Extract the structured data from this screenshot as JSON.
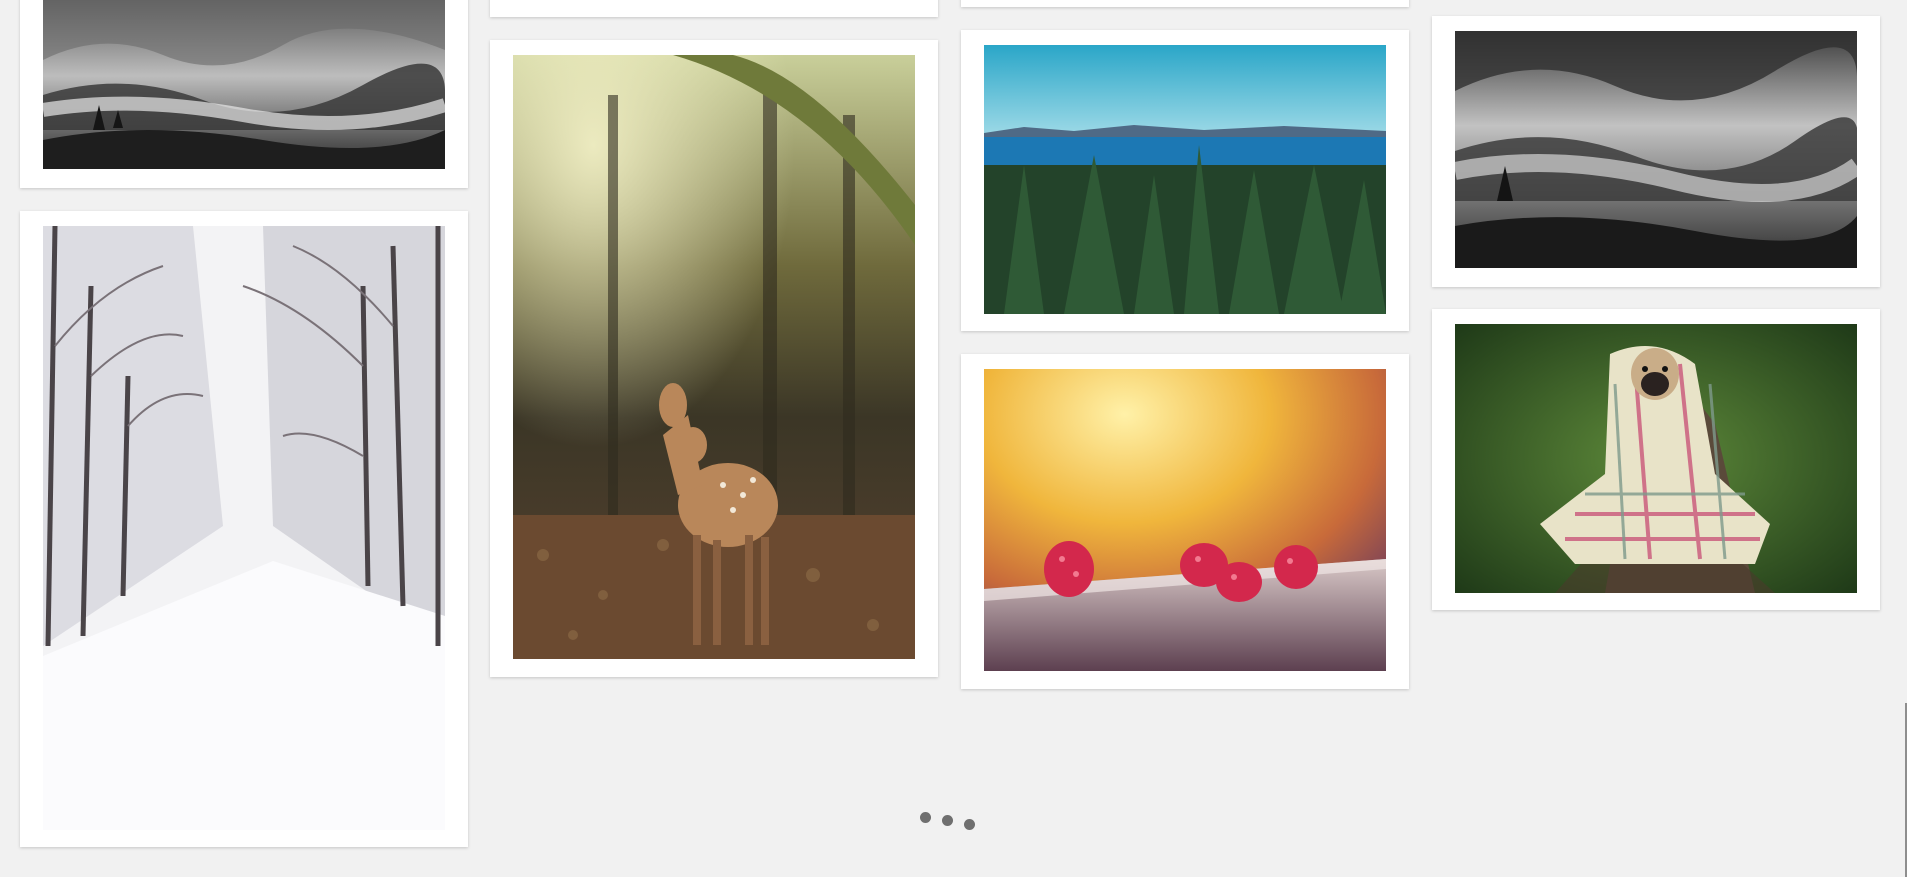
{
  "gallery": {
    "photos": [
      {
        "subject": "misty-forest-hills",
        "tone": "grayscale"
      },
      {
        "subject": "snowy-tree-lined-road",
        "tone": "winter-white"
      },
      {
        "subject": "fawn-in-forest",
        "tone": "warm-autumn"
      },
      {
        "subject": "pine-forest-by-sea",
        "tone": "blue-green"
      },
      {
        "subject": "raspberries-on-ledge",
        "tone": "warm-yellow"
      },
      {
        "subject": "misty-forest-hills",
        "tone": "grayscale"
      },
      {
        "subject": "pug-in-plaid-blanket",
        "tone": "green"
      }
    ]
  },
  "loader": {
    "dot_color": "#6f6f6f",
    "dot_count": 3
  },
  "colors": {
    "background": "#f1f1f1",
    "card": "#ffffff"
  }
}
